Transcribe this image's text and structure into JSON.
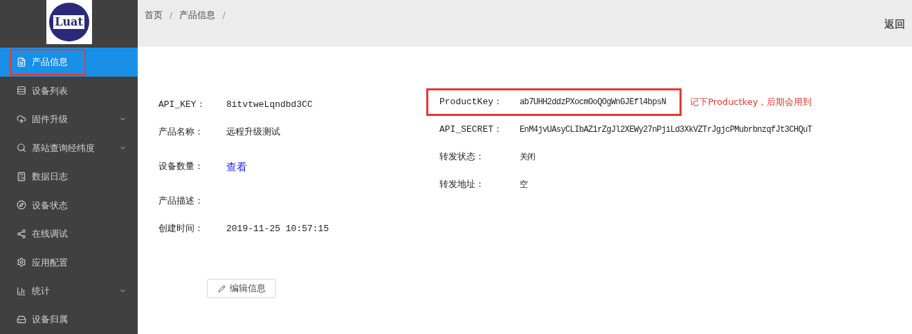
{
  "sidebar": {
    "logo": "Luat",
    "items": [
      {
        "label": "产品信息",
        "selected": true,
        "highlighted": true,
        "has_submenu": false
      },
      {
        "label": "设备列表",
        "selected": false,
        "highlighted": false,
        "has_submenu": false
      },
      {
        "label": "固件升级",
        "selected": false,
        "highlighted": false,
        "has_submenu": true
      },
      {
        "label": "基站查询经纬度",
        "selected": false,
        "highlighted": false,
        "has_submenu": true
      },
      {
        "label": "数据日志",
        "selected": false,
        "highlighted": false,
        "has_submenu": false
      },
      {
        "label": "设备状态",
        "selected": false,
        "highlighted": false,
        "has_submenu": false
      },
      {
        "label": "在线调试",
        "selected": false,
        "highlighted": false,
        "has_submenu": false
      },
      {
        "label": "应用配置",
        "selected": false,
        "highlighted": false,
        "has_submenu": false
      },
      {
        "label": "统计",
        "selected": false,
        "highlighted": false,
        "has_submenu": true
      },
      {
        "label": "设备归属",
        "selected": false,
        "highlighted": false,
        "has_submenu": false
      }
    ]
  },
  "breadcrumb": {
    "items": [
      "首页",
      "产品信息"
    ],
    "separator": "/"
  },
  "back": "返回",
  "left_fields": [
    {
      "label": "API_KEY：",
      "value": "8itvtweLqndbd3CC",
      "kind": "text"
    },
    {
      "label": "产品名称：",
      "value": "远程升级测试",
      "kind": "text"
    },
    {
      "label": "设备数量：",
      "value": "查看",
      "kind": "link"
    },
    {
      "label": "产品描述："
    },
    {
      "label": "创建时间：",
      "value": "2019-11-25 10:57:15",
      "kind": "text"
    }
  ],
  "right_fields": [
    {
      "label": "ProductKey：",
      "value": "ab7UHH2ddzPXocmOoQOgWnGJEfl4bpsN",
      "highlighted": true,
      "note": "记下Productkey，后期会用到"
    },
    {
      "label": "API_SECRET：",
      "value": "EnM4jvUAsyCLIbAZ1rZgJl2XEWy27nPjiLd3XkVZTrJgjcPMubrbnzqfJt3CHQuT",
      "highlighted": false
    },
    {
      "label": "转发状态：",
      "value": "关闭",
      "highlighted": false
    },
    {
      "label": "转发地址：",
      "value": "空",
      "highlighted": false
    }
  ],
  "edit_button": "编辑信息"
}
